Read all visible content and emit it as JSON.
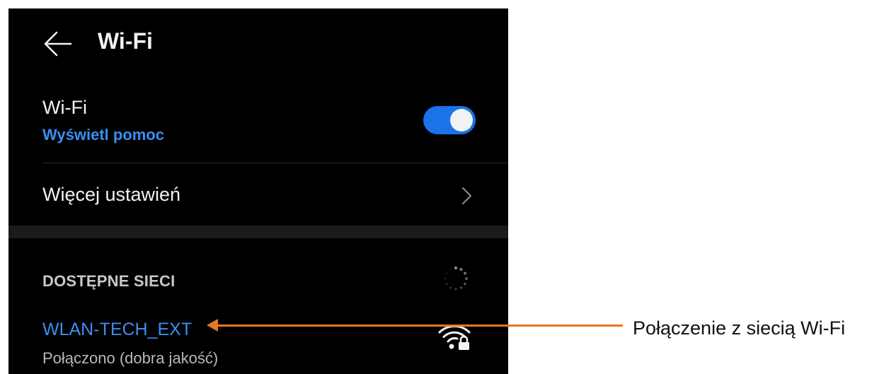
{
  "header": {
    "title": "Wi-Fi",
    "back_icon": "arrow-left-icon"
  },
  "wifi_row": {
    "label": "Wi-Fi",
    "help_link": "Wyświetl pomoc",
    "toggle_on": true
  },
  "more_row": {
    "label": "Więcej ustawień",
    "icon": "chevron-right-icon"
  },
  "networks": {
    "section_title": "DOSTĘPNE SIECI",
    "spinner_icon": "loading-spinner-icon",
    "items": [
      {
        "name": "WLAN-TECH_EXT",
        "status": "Połączono (dobra jakość)",
        "icon": "wifi-lock-icon"
      }
    ]
  },
  "annotation": {
    "text": "Połączenie z siecią Wi-Fi",
    "color": "#e87722"
  },
  "colors": {
    "accent": "#3a8ff0",
    "toggle": "#1a73e8",
    "background": "#000000"
  }
}
